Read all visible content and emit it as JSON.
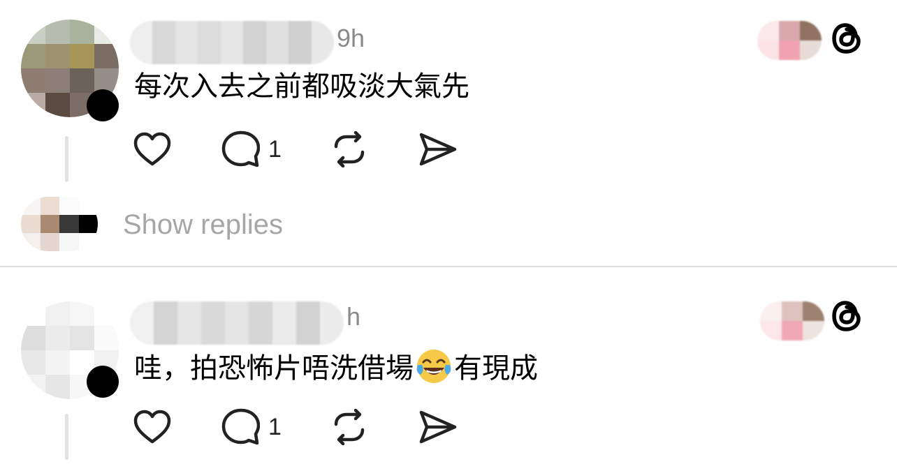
{
  "posts": [
    {
      "time": "9h",
      "text": "每次入去之前都吸淡大氣先",
      "reply_count": "1"
    },
    {
      "time": "h",
      "text_before_emoji": "哇，拍恐怖片唔洗借場",
      "emoji": "face-with-tears-of-joy",
      "text_after_emoji": "有現成",
      "reply_count": "1"
    }
  ],
  "show_replies_label": "Show replies",
  "icons": [
    "heart-icon",
    "comment-icon",
    "repost-icon",
    "share-icon",
    "threads-logo-icon"
  ]
}
